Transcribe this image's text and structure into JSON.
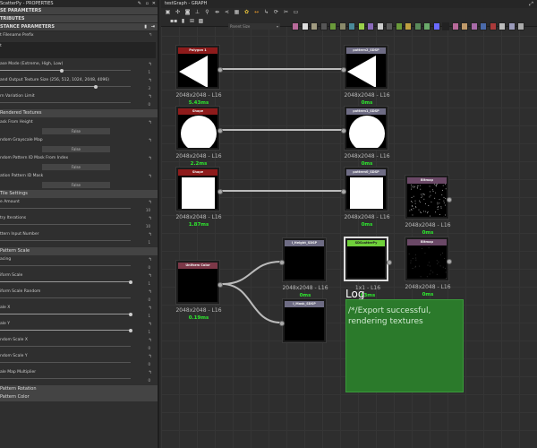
{
  "properties": {
    "title": "ScatterPy - PROPERTIES",
    "sections": [
      "SE PARAMETERS",
      "TRIBUTES",
      "STANCE PARAMETERS"
    ],
    "prefix_label": "t Filename Prefix",
    "prefix_value": "t",
    "sliders_top": [
      {
        "label": "ase Mode (Extreme, High, Low)",
        "value": "1",
        "fraction": 0.47
      },
      {
        "label": "and Output Texture Size (256, 512, 1024, 2048, 4096)",
        "value": "3",
        "fraction": 0.73
      },
      {
        "label": "rn Variation Limit",
        "value": "0",
        "fraction": 0
      }
    ],
    "group_rendered": "Rendered Textures",
    "bools": [
      {
        "label": "ask From Height",
        "value": "False"
      },
      {
        "label": "ndom Grayscale Map",
        "value": "False"
      },
      {
        "label": "ndom Pattern ID Mask From Index",
        "value": "False"
      },
      {
        "label": "ation Pattern ID Mask",
        "value": "False"
      }
    ],
    "group_tile": "Tile Settings",
    "tile_sliders": [
      {
        "label": "e Amount",
        "value": "10",
        "fraction": 0
      },
      {
        "label": "try Iterations",
        "value": "10",
        "fraction": 0
      },
      {
        "label": "ttern Input Number",
        "value": "1",
        "fraction": 0
      }
    ],
    "group_scale": "Pattern Scale",
    "scale_sliders": [
      {
        "label": "acing",
        "value": "0",
        "fraction": 0
      },
      {
        "label": "iform Scale",
        "value": "1",
        "fraction": 1
      },
      {
        "label": "iform Scale Random",
        "value": "0",
        "fraction": 0
      },
      {
        "label": "ale X",
        "value": "1",
        "fraction": 1
      },
      {
        "label": "ale Y",
        "value": "1",
        "fraction": 1
      },
      {
        "label": "ndom Scale X",
        "value": "0",
        "fraction": 0
      },
      {
        "label": "ndom Scale Y",
        "value": "0",
        "fraction": 0
      },
      {
        "label": "ale Map Multiplier",
        "value": "0",
        "fraction": 0
      }
    ],
    "group_rotation": "Pattern Rotation",
    "group_color": "Pattern Color"
  },
  "graph": {
    "title": "testGraph - GRAPH",
    "parent_size": "Parent Size",
    "nodes": [
      {
        "id": "polygon",
        "title": "Polygon 1",
        "res": "2048x2048 - L16",
        "time": "5.43ms",
        "color": "#8e1b1b",
        "thumb": "triangle-left"
      },
      {
        "id": "shape1",
        "title": "Shape",
        "res": "2048x2048 - L16",
        "time": "2.2ms",
        "color": "#8e1b1b",
        "thumb": "circle"
      },
      {
        "id": "shape2",
        "title": "Shape",
        "res": "2048x2048 - L16",
        "time": "1.87ms",
        "color": "#8e1b1b",
        "thumb": "square"
      },
      {
        "id": "pattern2",
        "title": "pattern2_SDSP",
        "res": "2048x2048 - L16",
        "time": "0ms",
        "color": "#6e6c84",
        "thumb": "triangle-left"
      },
      {
        "id": "pattern1",
        "title": "pattern1_SDSP",
        "res": "2048x2048 - L16",
        "time": "0ms",
        "color": "#6e6c84",
        "thumb": "circle"
      },
      {
        "id": "pattern0",
        "title": "pattern0_SDSP",
        "res": "2048x2048 - L16",
        "time": "0ms",
        "color": "#6e6c84",
        "thumb": "square"
      },
      {
        "id": "bitmap1",
        "title": "Bitmap",
        "res": "2048x2048 - L16",
        "time": "0ms",
        "color": "#6a4866",
        "thumb": "dots"
      },
      {
        "id": "uniform",
        "title": "Uniform Color",
        "res": "2048x2048 - L16",
        "time": "0.19ms",
        "color": "#7c3848",
        "thumb": "black"
      },
      {
        "id": "height",
        "title": "I_Height_SDSP",
        "res": "2048x2048 - L16",
        "time": "0ms",
        "color": "#6e6c84",
        "thumb": "black"
      },
      {
        "id": "mask",
        "title": "I_Mask_SDSP",
        "res": "",
        "time": "",
        "color": "#6e6c84",
        "thumb": "black"
      },
      {
        "id": "scatter",
        "title": "SDScatterPy",
        "res": "1x1 - L16",
        "time": "63ms",
        "color": "#6fd03a",
        "thumb": "black"
      },
      {
        "id": "bitmap2",
        "title": "Bitmap",
        "res": "2048x2048 - L16",
        "time": "0ms",
        "color": "#6a4866",
        "thumb": "faint"
      }
    ],
    "log_title": "Log",
    "log_text": "/*/Export successful, rendering textures"
  }
}
